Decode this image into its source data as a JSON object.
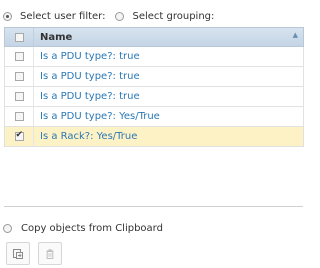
{
  "filter": {
    "user_filter_label": "Select user filter:",
    "grouping_label": "Select grouping:"
  },
  "grid": {
    "header": {
      "name": "Name"
    },
    "rows": [
      {
        "text": "Is a PDU type?: true",
        "checked": false
      },
      {
        "text": "Is a PDU type?: true",
        "checked": false
      },
      {
        "text": "Is a PDU type?: true",
        "checked": false
      },
      {
        "text": "Is a PDU type?: Yes/True",
        "checked": false
      },
      {
        "text": "Is a Rack?: Yes/True",
        "checked": true
      }
    ]
  },
  "clipboard": {
    "label": "Copy objects from Clipboard"
  },
  "toolbar": {
    "icons": [
      "paste-icon",
      "trash-icon"
    ]
  },
  "colors": {
    "header_bg": "#c5d5e6",
    "link": "#2a78b5",
    "selected_row": "#fdf1c6"
  }
}
